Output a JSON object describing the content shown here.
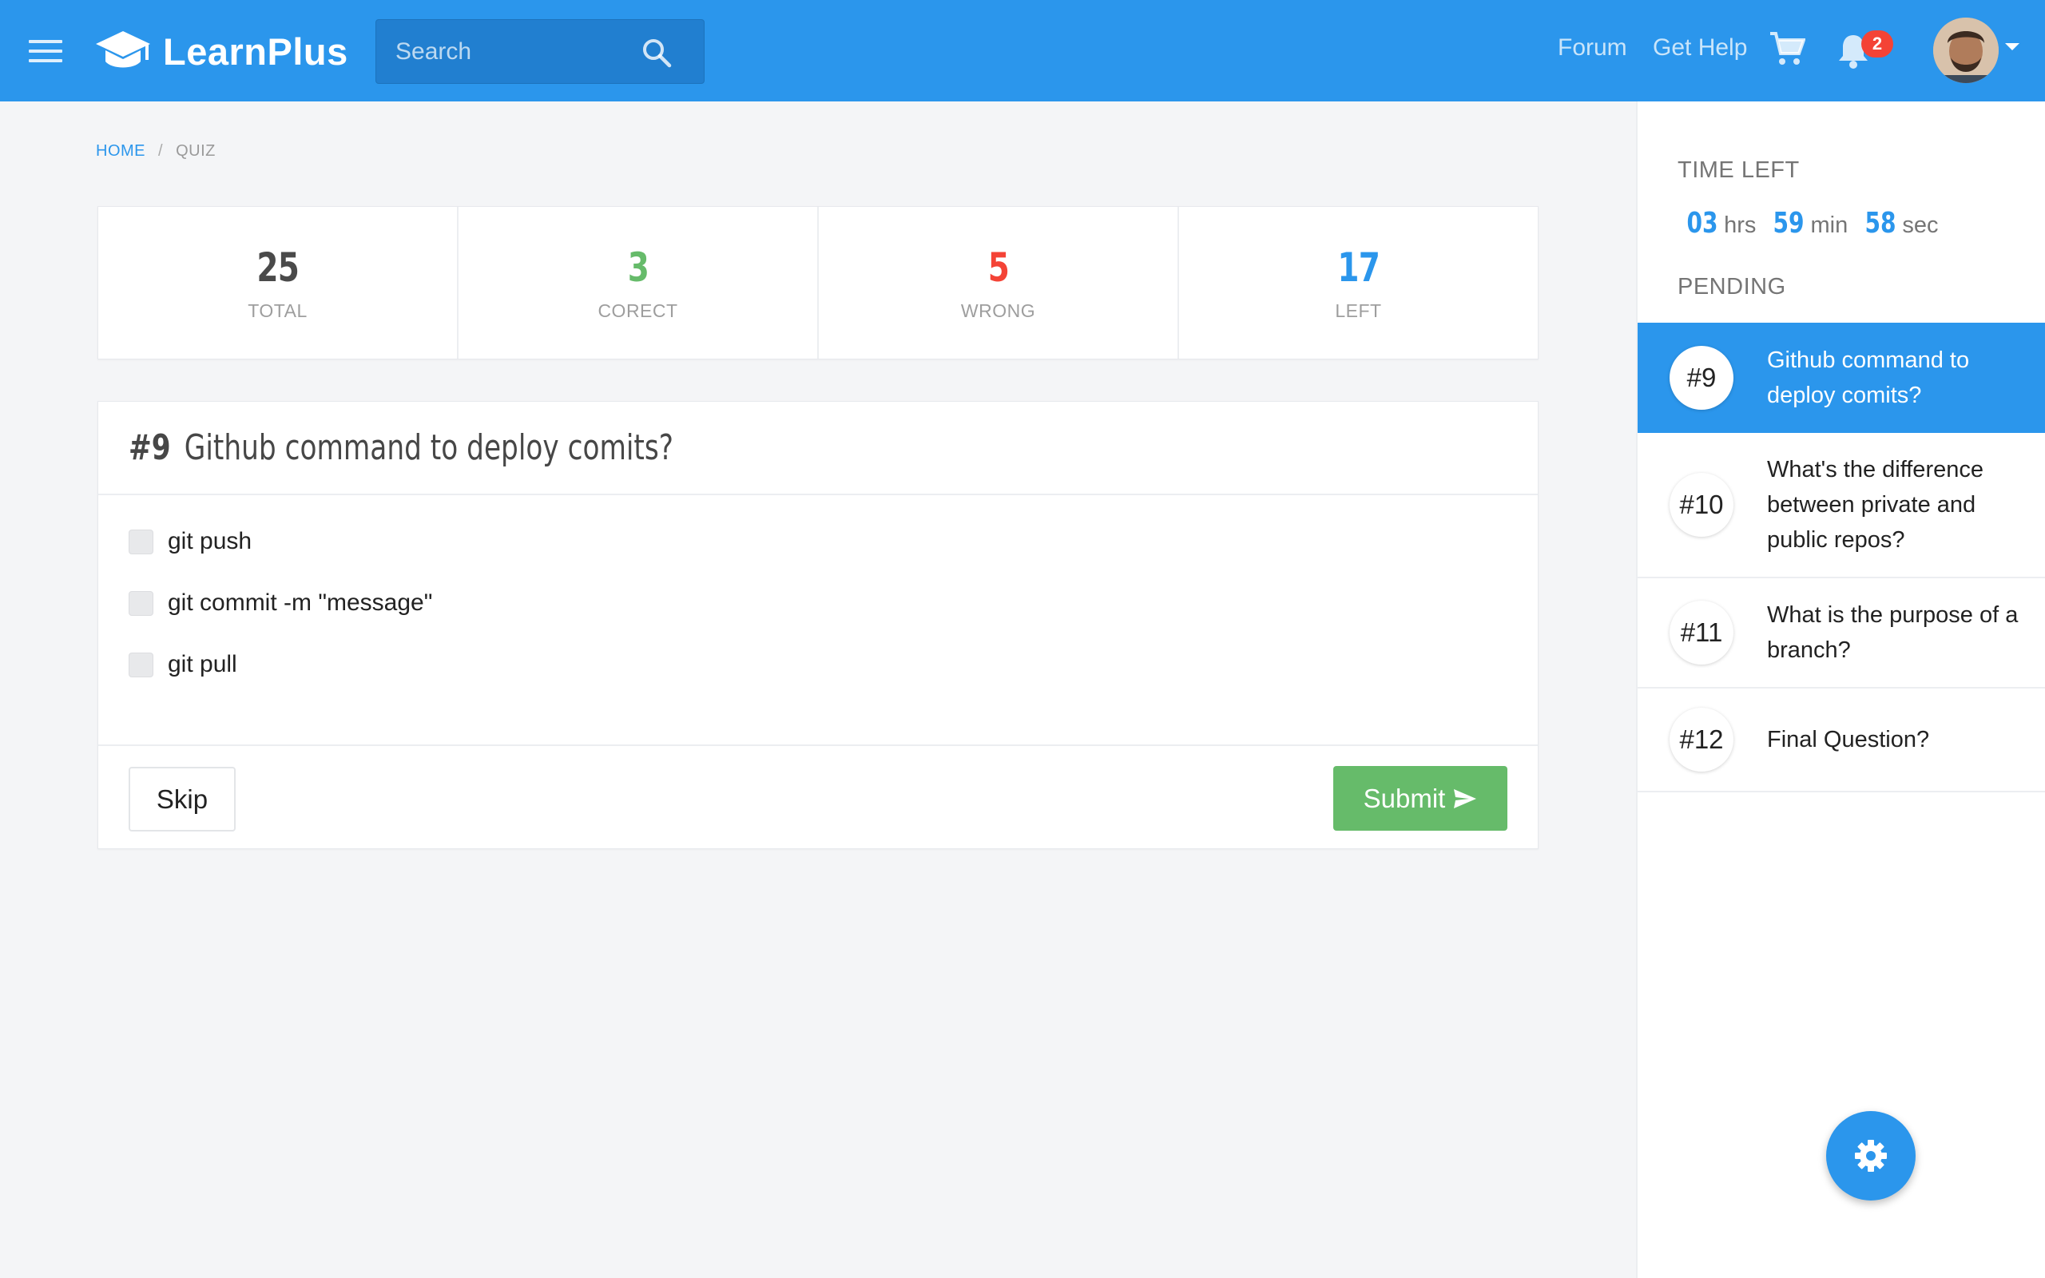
{
  "navbar": {
    "brand": "LearnPlus",
    "search_placeholder": "Search",
    "links": {
      "forum": "Forum",
      "help": "Get Help"
    },
    "notification_count": "2",
    "colors": {
      "primary": "#2b96ec",
      "badge": "#f44336"
    },
    "icons": [
      "menu-icon",
      "graduation-cap-icon",
      "search-icon",
      "cart-icon",
      "bell-icon",
      "caret-down-icon"
    ]
  },
  "breadcrumb": {
    "home": "HOME",
    "separator": "/",
    "current": "QUIZ"
  },
  "stats": [
    {
      "value": "25",
      "label": "TOTAL",
      "color": "#4a4a4a"
    },
    {
      "value": "3",
      "label": "CORECT",
      "color": "#66bb6a"
    },
    {
      "value": "5",
      "label": "WRONG",
      "color": "#f44336"
    },
    {
      "value": "17",
      "label": "LEFT",
      "color": "#2b96ec"
    }
  ],
  "question": {
    "number": "#9",
    "title": "Github command to deploy comits?",
    "options": [
      "git push",
      "git commit -m \"message\"",
      "git pull"
    ],
    "skip_label": "Skip",
    "submit_label": "Submit",
    "submit_color": "#66bb6a"
  },
  "sidebar": {
    "time_left_label": "TIME LEFT",
    "timer": {
      "hrs": "03",
      "hrs_unit": "hrs",
      "min": "59",
      "min_unit": "min",
      "sec": "58",
      "sec_unit": "sec"
    },
    "pending_label": "PENDING",
    "questions": [
      {
        "number": "#9",
        "text": "Github command to deploy comits?",
        "active": true
      },
      {
        "number": "#10",
        "text": "What's the difference between private and public repos?",
        "active": false
      },
      {
        "number": "#11",
        "text": "What is the purpose of a branch?",
        "active": false
      },
      {
        "number": "#12",
        "text": "Final Question?",
        "active": false
      }
    ]
  },
  "fab_icon": "gear-icon"
}
